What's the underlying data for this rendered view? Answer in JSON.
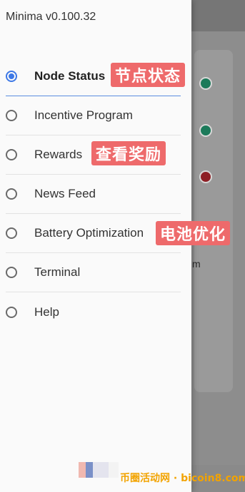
{
  "app": {
    "title": "Minima v0.100.32"
  },
  "menu": {
    "items": [
      {
        "label": "Node Status",
        "selected": true
      },
      {
        "label": "Incentive Program",
        "selected": false
      },
      {
        "label": "Rewards",
        "selected": false
      },
      {
        "label": "News Feed",
        "selected": false
      },
      {
        "label": "Battery Optimization",
        "selected": false
      },
      {
        "label": "Terminal",
        "selected": false
      },
      {
        "label": "Help",
        "selected": false
      }
    ]
  },
  "annotations": {
    "node_status": "节点状态",
    "rewards": "查看奖励",
    "battery": "电池优化"
  },
  "background": {
    "partial_text": "m"
  },
  "watermark": {
    "text": "币圈活动网 · bicoin8.com"
  },
  "colors": {
    "accent": "#3d78e6",
    "tag_bg": "#ee6a6b",
    "status_green": "#1c7a5a",
    "status_red": "#8e1f25"
  }
}
